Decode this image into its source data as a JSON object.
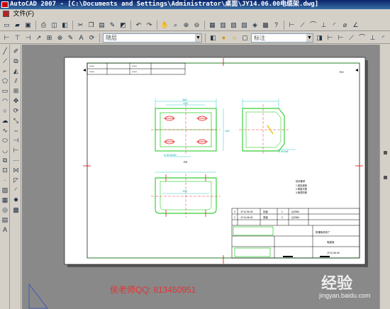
{
  "window": {
    "title": "AutoCAD 2007 - [C:\\Documents and Settings\\Administrator\\桌面\\JY14.06.00电缆架.dwg]"
  },
  "menu": {
    "file_label": "文件(F)"
  },
  "layer_combo": {
    "value": "随层"
  },
  "style_combo": {
    "value": "标注"
  },
  "drawing": {
    "title_small": "总图",
    "table_rows": [
      {
        "no": "2",
        "code": "JY14.06.02",
        "name": "挡板",
        "qty": "1",
        "mat": "Q235A"
      },
      {
        "no": "1",
        "code": "JY14.06.01",
        "name": "底板",
        "qty": "1",
        "mat": "Q235A"
      }
    ],
    "company": "防爆电机车厂",
    "part_name": "电缆架",
    "drawing_no": "JY14.06.00",
    "notes_title": "技术要求",
    "notes": [
      "1.锐边倒钝",
      "2.焊缝平整",
      "3.喷漆防锈"
    ],
    "dim_top": "160",
    "dim_inner": "130",
    "dim_side": "120",
    "dim_hole": "4-Φ13x30",
    "dim_bottom": "120",
    "dim_r": "R5",
    "dim_small": "4-Φ10x8"
  },
  "watermark": {
    "text": "侯老师QQ:   813450951"
  },
  "logo": {
    "text": "经验",
    "url": "jingyan.baidu.com"
  },
  "colors": {
    "title_bg": "#0a246a",
    "canvas_bg": "#898989",
    "sheet": "#ffffff",
    "line_green": "#00c000",
    "line_cyan": "#00c0c0",
    "line_red": "#e00000",
    "line_blue": "#0000ff"
  }
}
